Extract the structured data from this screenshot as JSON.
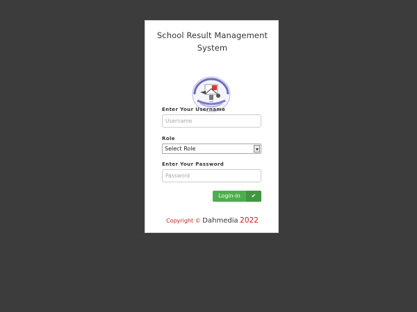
{
  "theme": {
    "background": "#3c3c3c",
    "accent": "#4cae4c",
    "copyright_color": "#cc2020"
  },
  "title_line1": "School Result Management",
  "title_line2": "System",
  "logo": {
    "icon": "school-crest-logo"
  },
  "username": {
    "label": "Enter Your Username",
    "placeholder": "Username",
    "value": ""
  },
  "role": {
    "label": "Role",
    "selected": "Select Role"
  },
  "password": {
    "label": "Enter Your Password",
    "placeholder": "Password",
    "value": ""
  },
  "login_button": {
    "label": "Login-in",
    "icon": "check-icon"
  },
  "footer": {
    "copyright": "Copyright ©",
    "brand": "Dahmedia",
    "year": "2022"
  }
}
